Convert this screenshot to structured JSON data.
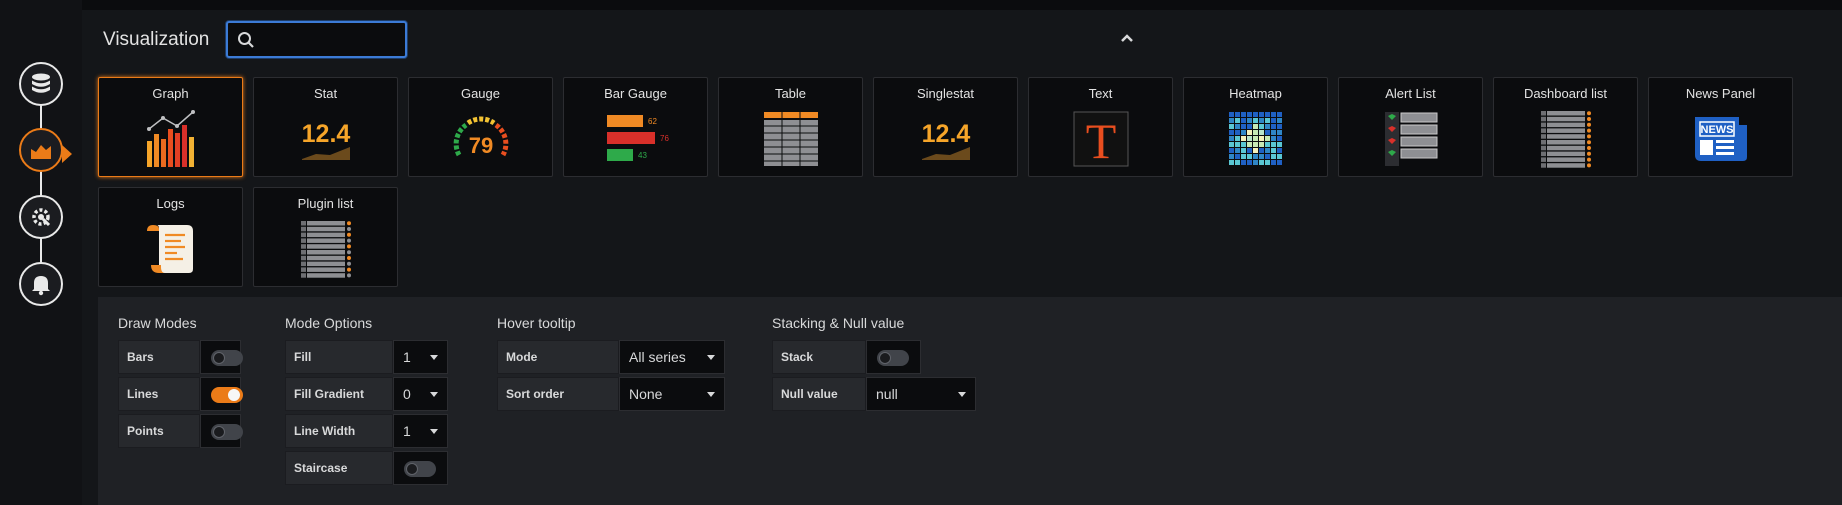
{
  "nav": {
    "items": [
      {
        "id": "queries",
        "icon": "database-icon",
        "active": false
      },
      {
        "id": "visualization",
        "icon": "chart-icon",
        "active": true
      },
      {
        "id": "general",
        "icon": "settings-icon",
        "active": false
      },
      {
        "id": "alert",
        "icon": "bell-icon",
        "active": false
      }
    ]
  },
  "header": {
    "title": "Visualization",
    "search": {
      "value": "",
      "placeholder": ""
    },
    "collapse_icon": "chevron-up-icon"
  },
  "visualizations": [
    {
      "label": "Graph",
      "selected": true
    },
    {
      "label": "Stat",
      "selected": false,
      "value": "12.4"
    },
    {
      "label": "Gauge",
      "selected": false,
      "value": "79"
    },
    {
      "label": "Bar Gauge",
      "selected": false,
      "values": [
        "62",
        "76",
        "43"
      ]
    },
    {
      "label": "Table",
      "selected": false
    },
    {
      "label": "Singlestat",
      "selected": false,
      "value": "12.4"
    },
    {
      "label": "Text",
      "selected": false,
      "glyph": "T"
    },
    {
      "label": "Heatmap",
      "selected": false
    },
    {
      "label": "Alert List",
      "selected": false
    },
    {
      "label": "Dashboard list",
      "selected": false
    },
    {
      "label": "News Panel",
      "selected": false,
      "badge": "NEWS"
    },
    {
      "label": "Logs",
      "selected": false
    },
    {
      "label": "Plugin list",
      "selected": false
    }
  ],
  "options": {
    "draw_modes": {
      "title": "Draw Modes",
      "rows": [
        {
          "label": "Bars",
          "on": false
        },
        {
          "label": "Lines",
          "on": true
        },
        {
          "label": "Points",
          "on": false
        }
      ]
    },
    "mode_options": {
      "title": "Mode Options",
      "fill": {
        "label": "Fill",
        "value": "1"
      },
      "fill_gradient": {
        "label": "Fill Gradient",
        "value": "0"
      },
      "line_width": {
        "label": "Line Width",
        "value": "1"
      },
      "staircase": {
        "label": "Staircase",
        "on": false
      }
    },
    "hover_tooltip": {
      "title": "Hover tooltip",
      "mode": {
        "label": "Mode",
        "value": "All series"
      },
      "sort_order": {
        "label": "Sort order",
        "value": "None"
      }
    },
    "stacking": {
      "title": "Stacking & Null value",
      "stack": {
        "label": "Stack",
        "on": false
      },
      "null_value": {
        "label": "Null value",
        "value": "null"
      }
    }
  },
  "colors": {
    "accent": "#eb7b18",
    "focus": "#3c7bd6",
    "bg": "#141619"
  }
}
